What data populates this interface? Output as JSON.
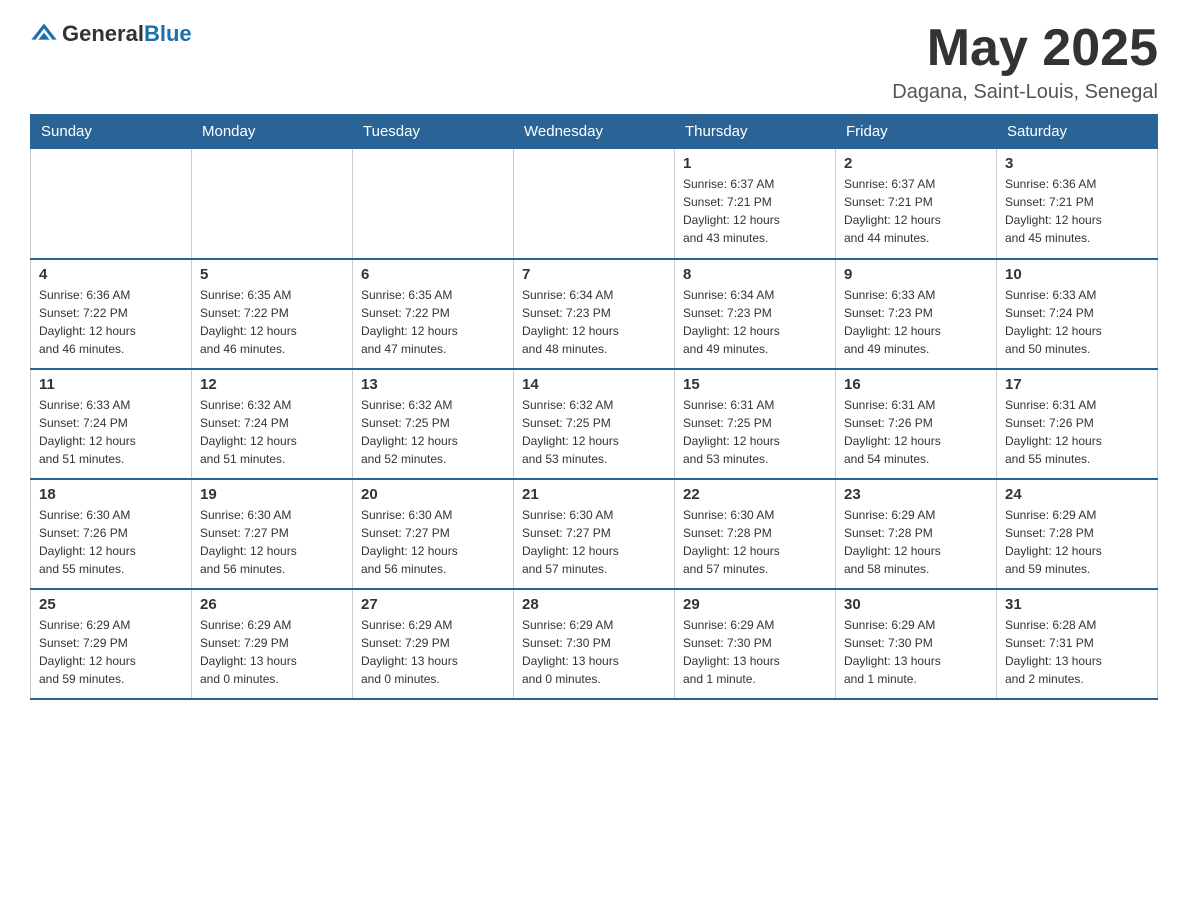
{
  "header": {
    "logo": {
      "text_general": "General",
      "text_blue": "Blue"
    },
    "title": "May 2025",
    "location": "Dagana, Saint-Louis, Senegal"
  },
  "calendar": {
    "days_of_week": [
      "Sunday",
      "Monday",
      "Tuesday",
      "Wednesday",
      "Thursday",
      "Friday",
      "Saturday"
    ],
    "weeks": [
      [
        {
          "day": "",
          "info": ""
        },
        {
          "day": "",
          "info": ""
        },
        {
          "day": "",
          "info": ""
        },
        {
          "day": "",
          "info": ""
        },
        {
          "day": "1",
          "info": "Sunrise: 6:37 AM\nSunset: 7:21 PM\nDaylight: 12 hours\nand 43 minutes."
        },
        {
          "day": "2",
          "info": "Sunrise: 6:37 AM\nSunset: 7:21 PM\nDaylight: 12 hours\nand 44 minutes."
        },
        {
          "day": "3",
          "info": "Sunrise: 6:36 AM\nSunset: 7:21 PM\nDaylight: 12 hours\nand 45 minutes."
        }
      ],
      [
        {
          "day": "4",
          "info": "Sunrise: 6:36 AM\nSunset: 7:22 PM\nDaylight: 12 hours\nand 46 minutes."
        },
        {
          "day": "5",
          "info": "Sunrise: 6:35 AM\nSunset: 7:22 PM\nDaylight: 12 hours\nand 46 minutes."
        },
        {
          "day": "6",
          "info": "Sunrise: 6:35 AM\nSunset: 7:22 PM\nDaylight: 12 hours\nand 47 minutes."
        },
        {
          "day": "7",
          "info": "Sunrise: 6:34 AM\nSunset: 7:23 PM\nDaylight: 12 hours\nand 48 minutes."
        },
        {
          "day": "8",
          "info": "Sunrise: 6:34 AM\nSunset: 7:23 PM\nDaylight: 12 hours\nand 49 minutes."
        },
        {
          "day": "9",
          "info": "Sunrise: 6:33 AM\nSunset: 7:23 PM\nDaylight: 12 hours\nand 49 minutes."
        },
        {
          "day": "10",
          "info": "Sunrise: 6:33 AM\nSunset: 7:24 PM\nDaylight: 12 hours\nand 50 minutes."
        }
      ],
      [
        {
          "day": "11",
          "info": "Sunrise: 6:33 AM\nSunset: 7:24 PM\nDaylight: 12 hours\nand 51 minutes."
        },
        {
          "day": "12",
          "info": "Sunrise: 6:32 AM\nSunset: 7:24 PM\nDaylight: 12 hours\nand 51 minutes."
        },
        {
          "day": "13",
          "info": "Sunrise: 6:32 AM\nSunset: 7:25 PM\nDaylight: 12 hours\nand 52 minutes."
        },
        {
          "day": "14",
          "info": "Sunrise: 6:32 AM\nSunset: 7:25 PM\nDaylight: 12 hours\nand 53 minutes."
        },
        {
          "day": "15",
          "info": "Sunrise: 6:31 AM\nSunset: 7:25 PM\nDaylight: 12 hours\nand 53 minutes."
        },
        {
          "day": "16",
          "info": "Sunrise: 6:31 AM\nSunset: 7:26 PM\nDaylight: 12 hours\nand 54 minutes."
        },
        {
          "day": "17",
          "info": "Sunrise: 6:31 AM\nSunset: 7:26 PM\nDaylight: 12 hours\nand 55 minutes."
        }
      ],
      [
        {
          "day": "18",
          "info": "Sunrise: 6:30 AM\nSunset: 7:26 PM\nDaylight: 12 hours\nand 55 minutes."
        },
        {
          "day": "19",
          "info": "Sunrise: 6:30 AM\nSunset: 7:27 PM\nDaylight: 12 hours\nand 56 minutes."
        },
        {
          "day": "20",
          "info": "Sunrise: 6:30 AM\nSunset: 7:27 PM\nDaylight: 12 hours\nand 56 minutes."
        },
        {
          "day": "21",
          "info": "Sunrise: 6:30 AM\nSunset: 7:27 PM\nDaylight: 12 hours\nand 57 minutes."
        },
        {
          "day": "22",
          "info": "Sunrise: 6:30 AM\nSunset: 7:28 PM\nDaylight: 12 hours\nand 57 minutes."
        },
        {
          "day": "23",
          "info": "Sunrise: 6:29 AM\nSunset: 7:28 PM\nDaylight: 12 hours\nand 58 minutes."
        },
        {
          "day": "24",
          "info": "Sunrise: 6:29 AM\nSunset: 7:28 PM\nDaylight: 12 hours\nand 59 minutes."
        }
      ],
      [
        {
          "day": "25",
          "info": "Sunrise: 6:29 AM\nSunset: 7:29 PM\nDaylight: 12 hours\nand 59 minutes."
        },
        {
          "day": "26",
          "info": "Sunrise: 6:29 AM\nSunset: 7:29 PM\nDaylight: 13 hours\nand 0 minutes."
        },
        {
          "day": "27",
          "info": "Sunrise: 6:29 AM\nSunset: 7:29 PM\nDaylight: 13 hours\nand 0 minutes."
        },
        {
          "day": "28",
          "info": "Sunrise: 6:29 AM\nSunset: 7:30 PM\nDaylight: 13 hours\nand 0 minutes."
        },
        {
          "day": "29",
          "info": "Sunrise: 6:29 AM\nSunset: 7:30 PM\nDaylight: 13 hours\nand 1 minute."
        },
        {
          "day": "30",
          "info": "Sunrise: 6:29 AM\nSunset: 7:30 PM\nDaylight: 13 hours\nand 1 minute."
        },
        {
          "day": "31",
          "info": "Sunrise: 6:28 AM\nSunset: 7:31 PM\nDaylight: 13 hours\nand 2 minutes."
        }
      ]
    ]
  }
}
